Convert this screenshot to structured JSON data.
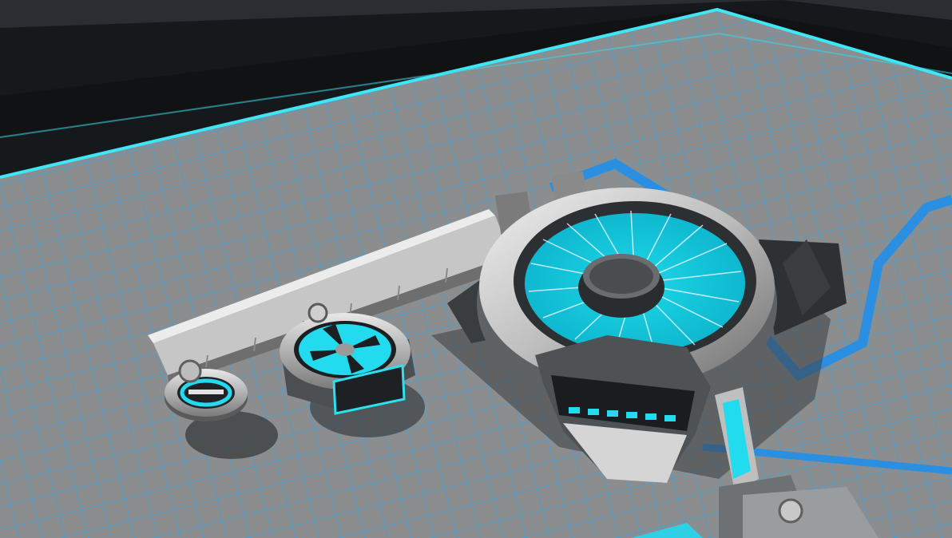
{
  "scene": {
    "type": "3d-build-editor-viewport",
    "description_free": true,
    "colors": {
      "accent_cyan": "#27e6f2",
      "accent_blue": "#2f8fe6",
      "floor_gray": "#8a8c8e",
      "grid_line": "#33aef0",
      "wall_dark": "#141619",
      "metal_light": "#d8d8d8",
      "metal_mid": "#9c9c9c",
      "metal_dark": "#4a4a4a"
    },
    "icons": {
      "large_part": "turbine-engine-icon",
      "medium_part": "fan-rotor-icon",
      "small_part": "small-rotor-icon",
      "tool": "builder-tool-icon"
    }
  }
}
